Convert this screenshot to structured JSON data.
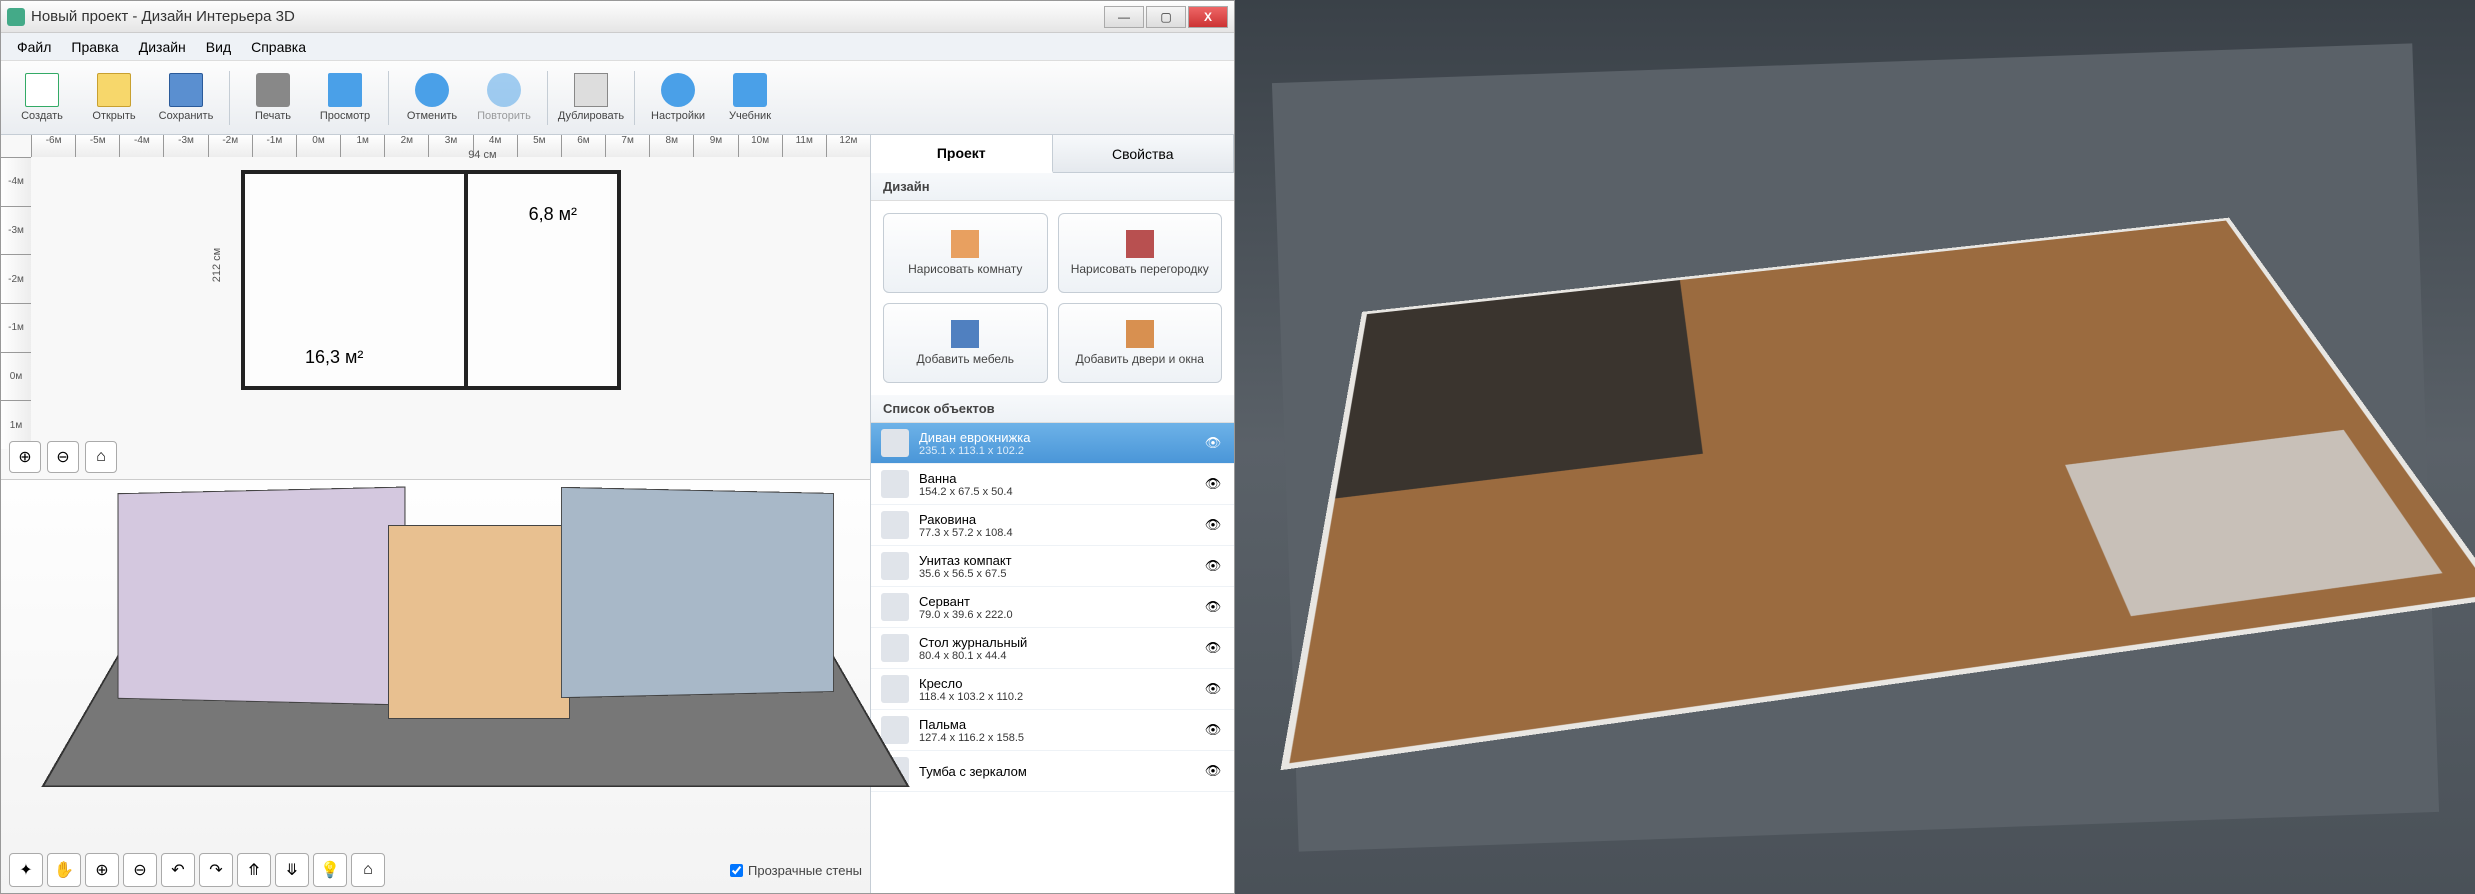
{
  "titlebar": {
    "title": "Новый проект - Дизайн Интерьера 3D"
  },
  "menu": {
    "file": "Файл",
    "edit": "Правка",
    "design": "Дизайн",
    "view": "Вид",
    "help": "Справка"
  },
  "toolbar": {
    "new": "Создать",
    "open": "Открыть",
    "save": "Сохранить",
    "print": "Печать",
    "preview": "Просмотр",
    "undo": "Отменить",
    "redo": "Повторить",
    "duplicate": "Дублировать",
    "settings": "Настройки",
    "tutorial": "Учебник"
  },
  "ruler": [
    "-6м",
    "-5м",
    "-4м",
    "-3м",
    "-2м",
    "-1м",
    "0м",
    "1м",
    "2м",
    "3м",
    "4м",
    "5м",
    "6м",
    "7м",
    "8м",
    "9м",
    "10м",
    "11м",
    "12м"
  ],
  "rulerv": [
    "-4м",
    "-3м",
    "-2м",
    "-1м",
    "0м",
    "1м"
  ],
  "plan": {
    "room1": "16,3 м²",
    "room2": "6,8 м²",
    "dimh": "94 см",
    "dimv": "212 см"
  },
  "transparent_walls": "Прозрачные стены",
  "tabs": {
    "project": "Проект",
    "properties": "Свойства"
  },
  "design_section": "Дизайн",
  "design_buttons": {
    "draw_room": "Нарисовать комнату",
    "draw_wall": "Нарисовать перегородку",
    "add_furniture": "Добавить мебель",
    "add_doors": "Добавить двери и окна"
  },
  "objects_section": "Список объектов",
  "objects": [
    {
      "name": "Диван еврокнижка",
      "dims": "235.1 x 113.1 x 102.2"
    },
    {
      "name": "Ванна",
      "dims": "154.2 x 67.5 x 50.4"
    },
    {
      "name": "Раковина",
      "dims": "77.3 x 57.2 x 108.4"
    },
    {
      "name": "Унитаз компакт",
      "dims": "35.6 x 56.5 x 67.5"
    },
    {
      "name": "Сервант",
      "dims": "79.0 x 39.6 x 222.0"
    },
    {
      "name": "Стол журнальный",
      "dims": "80.4 x 80.1 x 44.4"
    },
    {
      "name": "Кресло",
      "dims": "118.4 x 103.2 x 110.2"
    },
    {
      "name": "Пальма",
      "dims": "127.4 x 116.2 x 158.5"
    },
    {
      "name": "Тумба с зеркалом",
      "dims": ""
    }
  ]
}
